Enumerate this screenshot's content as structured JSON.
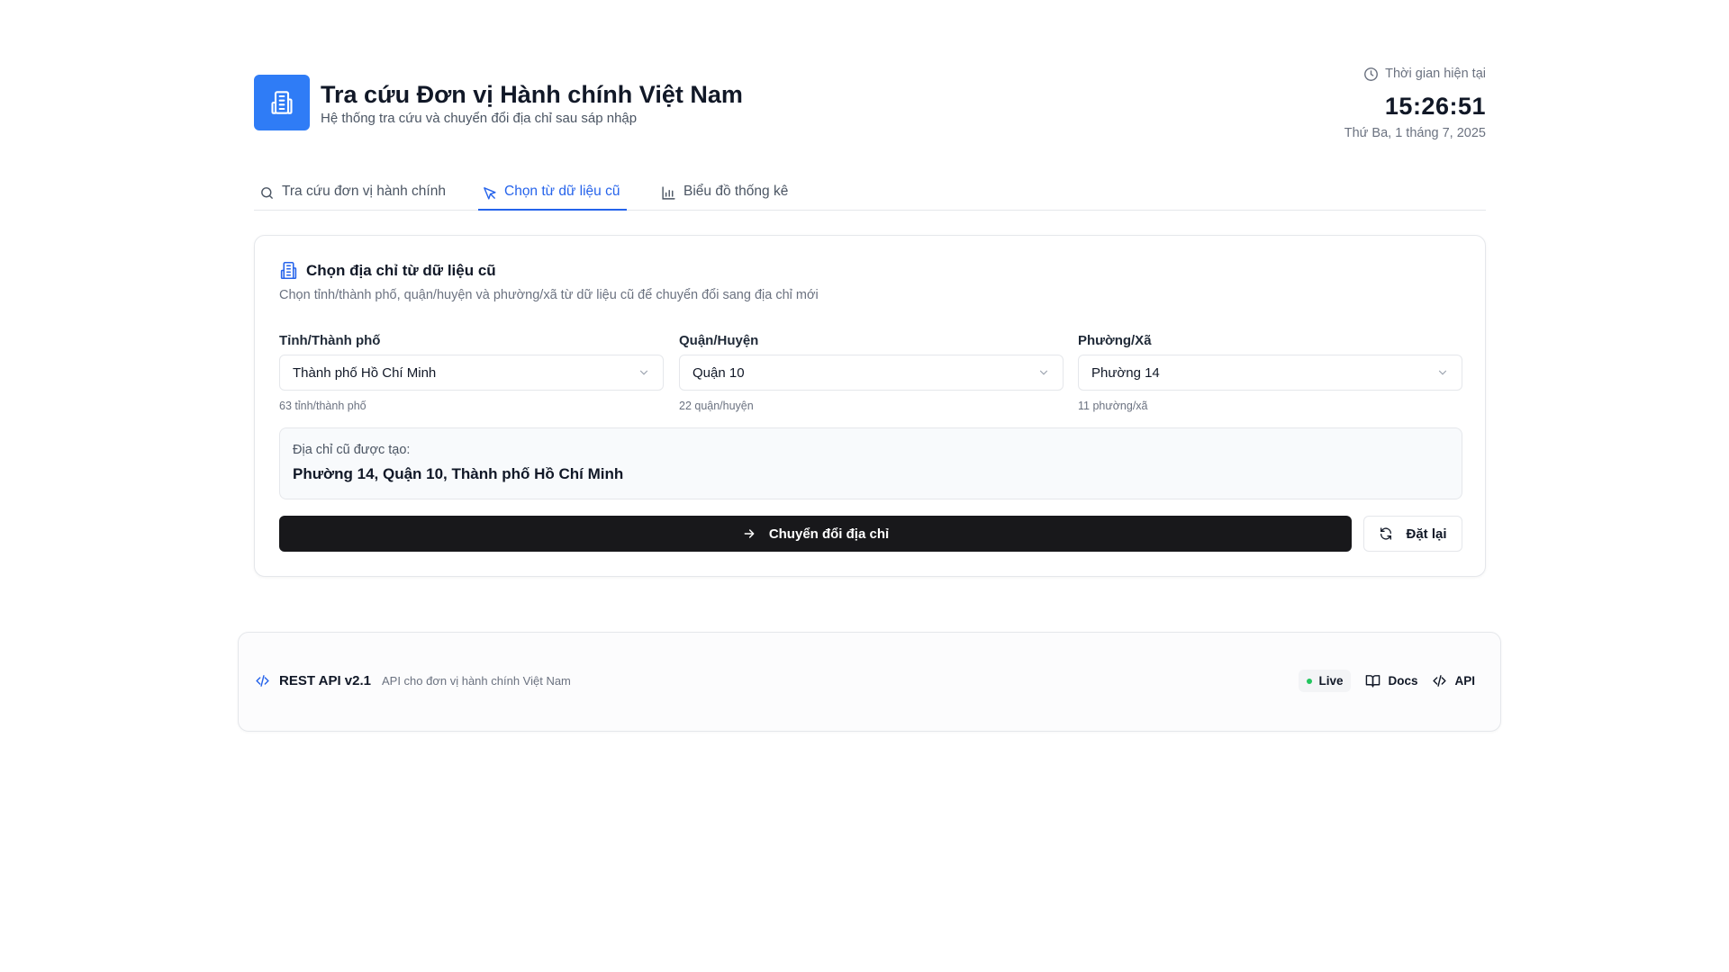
{
  "header": {
    "title": "Tra cứu Đơn vị Hành chính Việt Nam",
    "subtitle": "Hệ thống tra cứu và chuyển đổi địa chỉ sau sáp nhập",
    "logo_icon": "building-icon",
    "accent_color": "#2f7cf6"
  },
  "clock": {
    "label": "Thời gian hiện tại",
    "time": "15:26:51",
    "date": "Thứ Ba, 1 tháng 7, 2025"
  },
  "tabs": [
    {
      "label": "Tra cứu đơn vị hành chính",
      "icon": "search-icon",
      "active": false
    },
    {
      "label": "Chọn từ dữ liệu cũ",
      "icon": "pointer-icon",
      "active": true
    },
    {
      "label": "Biểu đồ thống kê",
      "icon": "bar-chart-icon",
      "active": false
    }
  ],
  "card": {
    "title": "Chọn địa chỉ từ dữ liệu cũ",
    "description": "Chọn tỉnh/thành phố, quận/huyện và phường/xã từ dữ liệu cũ để chuyển đổi sang địa chỉ mới",
    "fields": [
      {
        "label": "Tỉnh/Thành phố",
        "value": "Thành phố Hồ Chí Minh",
        "count": "63 tỉnh/thành phố"
      },
      {
        "label": "Quận/Huyện",
        "value": "Quận 10",
        "count": "22 quận/huyện"
      },
      {
        "label": "Phường/Xã",
        "value": "Phường 14",
        "count": "11 phường/xã"
      }
    ],
    "address_label": "Địa chỉ cũ được tạo:",
    "address_value": "Phường 14, Quận 10, Thành phố Hồ Chí Minh",
    "convert_label": "Chuyển đổi địa chỉ",
    "reset_label": "Đặt lại"
  },
  "footer": {
    "api_name": "REST API v2.1",
    "api_desc": "API cho đơn vị hành chính Việt Nam",
    "live_label": "Live",
    "docs_label": "Docs",
    "api_label": "API",
    "status_color": "#22c55e"
  }
}
